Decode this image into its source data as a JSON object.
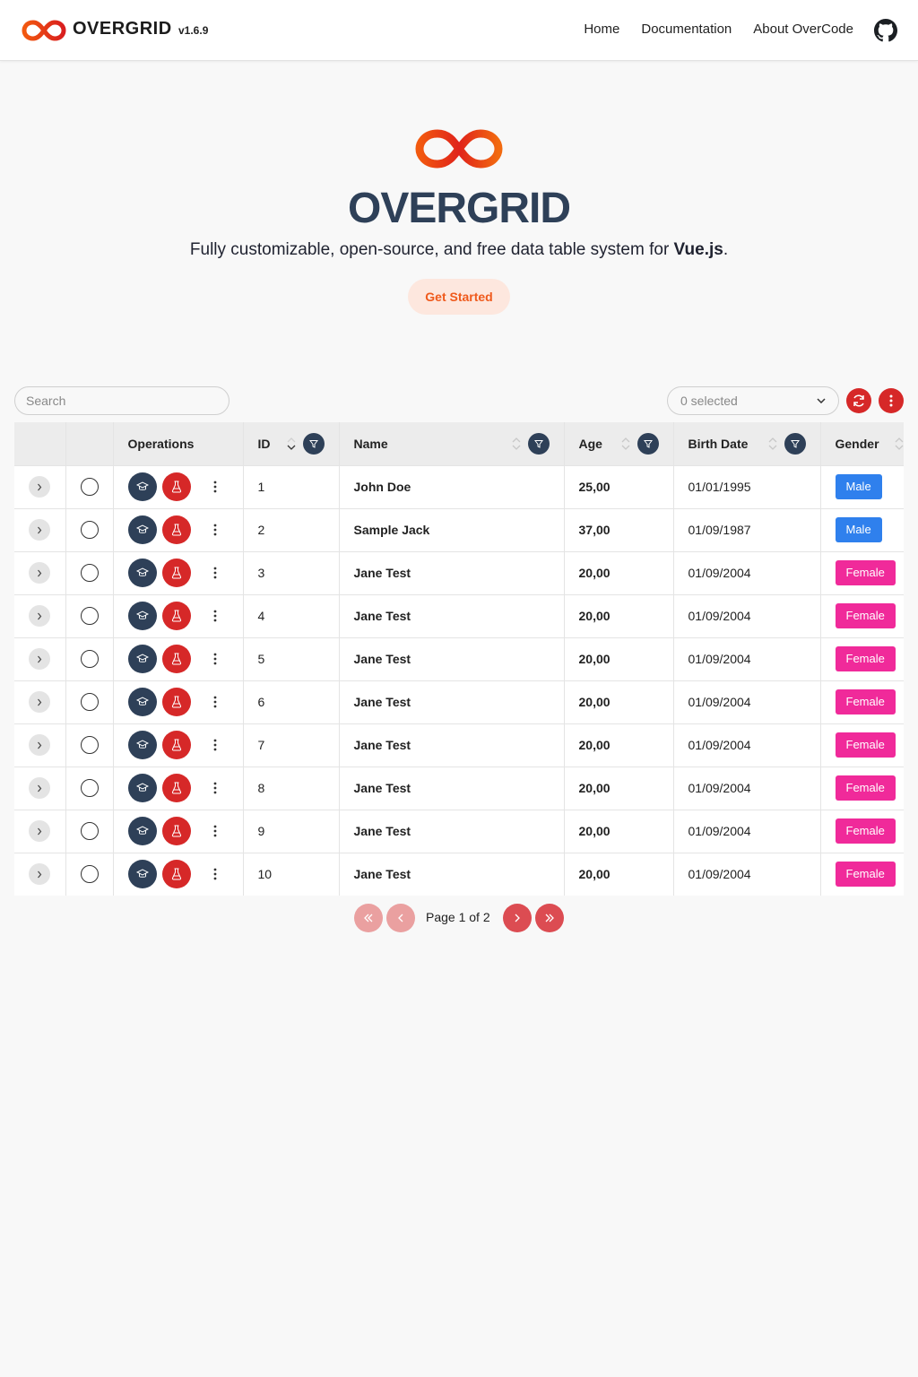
{
  "nav": {
    "brand": "OVERGRID",
    "version": "v1.6.9",
    "links": [
      "Home",
      "Documentation",
      "About OverCode"
    ],
    "github_icon": "github-icon"
  },
  "hero": {
    "title": "OVERGRID",
    "tagline_prefix": "Fully customizable, open-source, and free data table system for ",
    "tagline_bold": "Vue.js",
    "tagline_suffix": ".",
    "cta": "Get Started"
  },
  "toolbar": {
    "search_placeholder": "Search",
    "selected_label": "0 selected",
    "refresh_icon": "refresh-icon",
    "menu_icon": "kebab-menu-icon"
  },
  "table": {
    "columns": [
      "",
      "",
      "Operations",
      "ID",
      "Name",
      "Age",
      "Birth Date",
      "Gender"
    ],
    "rows": [
      {
        "id": "1",
        "name": "John Doe",
        "age": "25,00",
        "birth": "01/01/1995",
        "gender": "Male"
      },
      {
        "id": "2",
        "name": "Sample Jack",
        "age": "37,00",
        "birth": "01/09/1987",
        "gender": "Male"
      },
      {
        "id": "3",
        "name": "Jane Test",
        "age": "20,00",
        "birth": "01/09/2004",
        "gender": "Female"
      },
      {
        "id": "4",
        "name": "Jane Test",
        "age": "20,00",
        "birth": "01/09/2004",
        "gender": "Female"
      },
      {
        "id": "5",
        "name": "Jane Test",
        "age": "20,00",
        "birth": "01/09/2004",
        "gender": "Female"
      },
      {
        "id": "6",
        "name": "Jane Test",
        "age": "20,00",
        "birth": "01/09/2004",
        "gender": "Female"
      },
      {
        "id": "7",
        "name": "Jane Test",
        "age": "20,00",
        "birth": "01/09/2004",
        "gender": "Female"
      },
      {
        "id": "8",
        "name": "Jane Test",
        "age": "20,00",
        "birth": "01/09/2004",
        "gender": "Female"
      },
      {
        "id": "9",
        "name": "Jane Test",
        "age": "20,00",
        "birth": "01/09/2004",
        "gender": "Female"
      },
      {
        "id": "10",
        "name": "Jane Test",
        "age": "20,00",
        "birth": "01/09/2004",
        "gender": "Female"
      }
    ]
  },
  "pagination": {
    "label": "Page 1 of 2",
    "current_page": 1,
    "total_pages": 2
  },
  "colors": {
    "accent_dark": "#2e4058",
    "accent_red": "#d62828",
    "brand_orange": "#ef5a1c",
    "male": "#2f80ed",
    "female": "#f02a9a"
  }
}
